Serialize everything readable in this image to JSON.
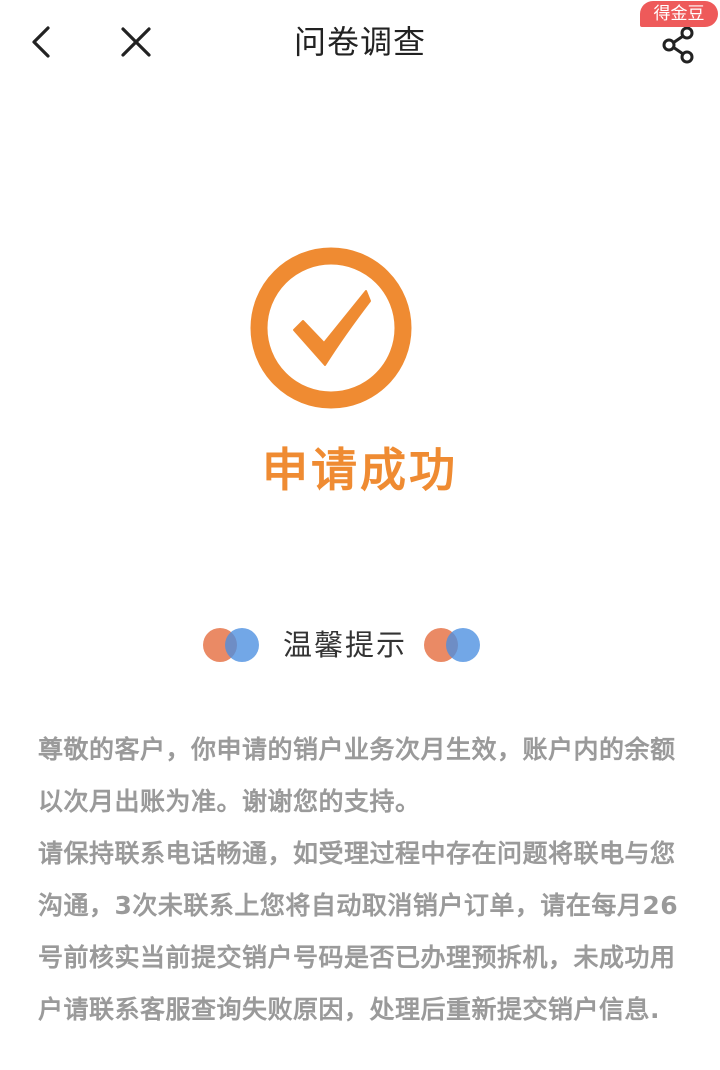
{
  "header": {
    "title": "问卷调查",
    "reward_badge": "得金豆",
    "icons": {
      "back": "chevron-left-icon",
      "close": "close-icon",
      "share": "share-icon"
    }
  },
  "result": {
    "icon": "check-circle-icon",
    "title": "申请成功",
    "accent_color": "#ef8b32"
  },
  "tips": {
    "title": "温馨提示",
    "paragraphs": [
      "尊敬的客户，你申请的销户业务次月生效，账户内的余额以次月出账为准。谢谢您的支持。",
      "请保持联系电话畅通，如受理过程中存在问题将联电与您沟通，3次未联系上您将自动取消销户订单，请在每月26号前核实当前提交销户号码是否已办理预拆机，未成功用户请联系客服查询失败原因，处理后重新提交销户信息."
    ],
    "dot_colors": [
      "#e87d54",
      "#4a8ee0"
    ]
  }
}
